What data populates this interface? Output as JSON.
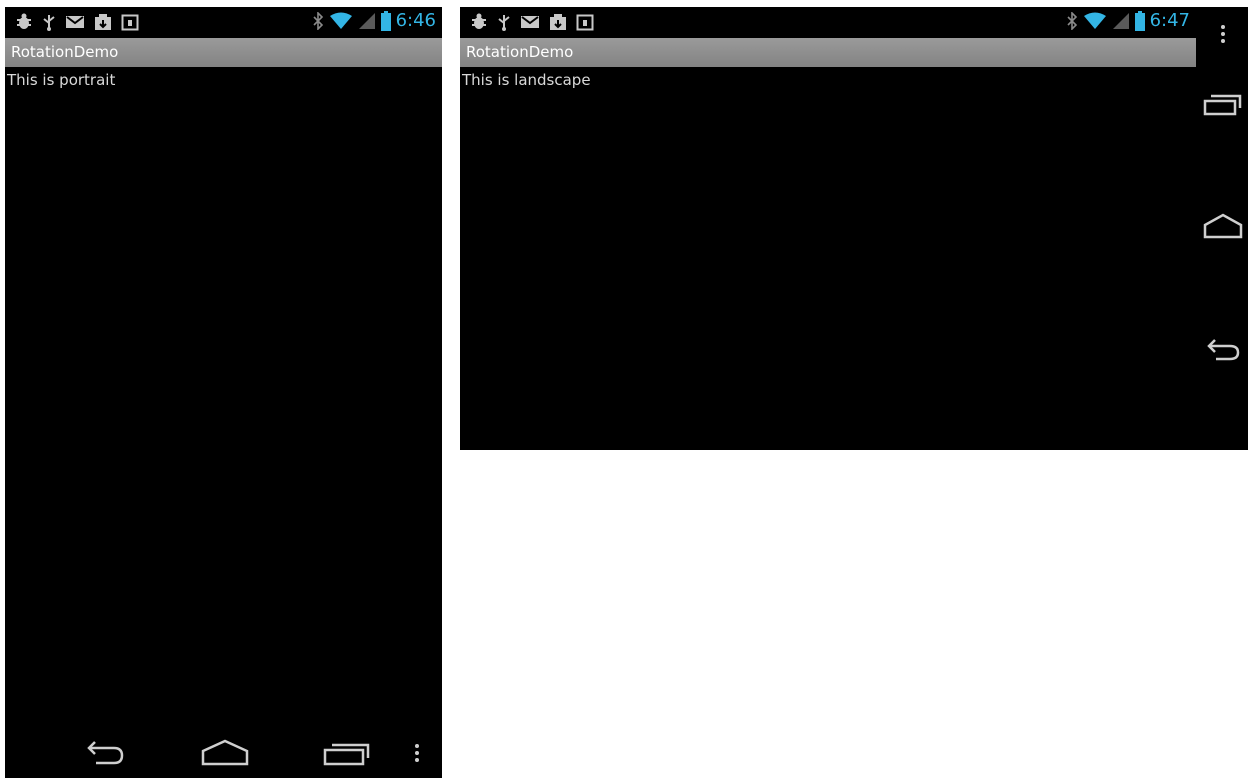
{
  "portrait": {
    "clock": "6:46",
    "app_title": "RotationDemo",
    "content_text": "This is portrait",
    "status_icons_left": [
      "bug-icon",
      "usb-icon",
      "gmail-icon",
      "download-icon",
      "calendar-icon"
    ],
    "status_icons_right": [
      "bluetooth-icon",
      "wifi-icon",
      "signal-icon",
      "battery-icon"
    ],
    "nav_buttons": [
      "back-icon",
      "home-icon",
      "recents-icon",
      "menu-icon"
    ]
  },
  "landscape": {
    "clock": "6:47",
    "app_title": "RotationDemo",
    "content_text": "This is landscape",
    "status_icons_left": [
      "bug-icon",
      "usb-icon",
      "gmail-icon",
      "download-icon",
      "calendar-icon"
    ],
    "status_icons_right": [
      "bluetooth-icon",
      "wifi-icon",
      "signal-icon",
      "battery-icon"
    ],
    "nav_buttons": [
      "menu-icon",
      "recents-icon",
      "home-icon",
      "back-icon"
    ]
  },
  "colors": {
    "clock_accent": "#33b5e5",
    "titlebar": "#8f8f8f",
    "screen_bg": "#000000",
    "page_bg": "#ffffff"
  }
}
